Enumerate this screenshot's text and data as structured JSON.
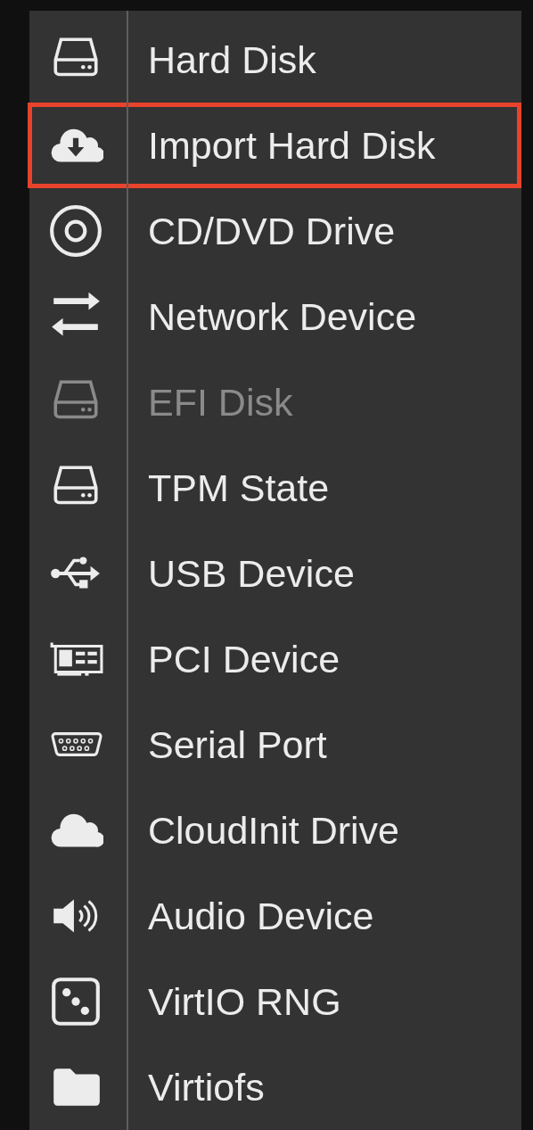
{
  "menu": {
    "items": [
      {
        "label": "Hard Disk",
        "kind": "disk",
        "disabled": false,
        "highlighted": false
      },
      {
        "label": "Import Hard Disk",
        "kind": "cloud-download",
        "disabled": false,
        "highlighted": true
      },
      {
        "label": "CD/DVD Drive",
        "kind": "disc",
        "disabled": false,
        "highlighted": false
      },
      {
        "label": "Network Device",
        "kind": "arrows",
        "disabled": false,
        "highlighted": false
      },
      {
        "label": "EFI Disk",
        "kind": "disk",
        "disabled": true,
        "highlighted": false
      },
      {
        "label": "TPM State",
        "kind": "disk",
        "disabled": false,
        "highlighted": false
      },
      {
        "label": "USB Device",
        "kind": "usb",
        "disabled": false,
        "highlighted": false
      },
      {
        "label": "PCI Device",
        "kind": "pci",
        "disabled": false,
        "highlighted": false
      },
      {
        "label": "Serial Port",
        "kind": "serial",
        "disabled": false,
        "highlighted": false
      },
      {
        "label": "CloudInit Drive",
        "kind": "cloud",
        "disabled": false,
        "highlighted": false
      },
      {
        "label": "Audio Device",
        "kind": "speaker",
        "disabled": false,
        "highlighted": false
      },
      {
        "label": "VirtIO RNG",
        "kind": "dice",
        "disabled": false,
        "highlighted": false
      },
      {
        "label": "Virtiofs",
        "kind": "folder",
        "disabled": false,
        "highlighted": false
      }
    ]
  }
}
